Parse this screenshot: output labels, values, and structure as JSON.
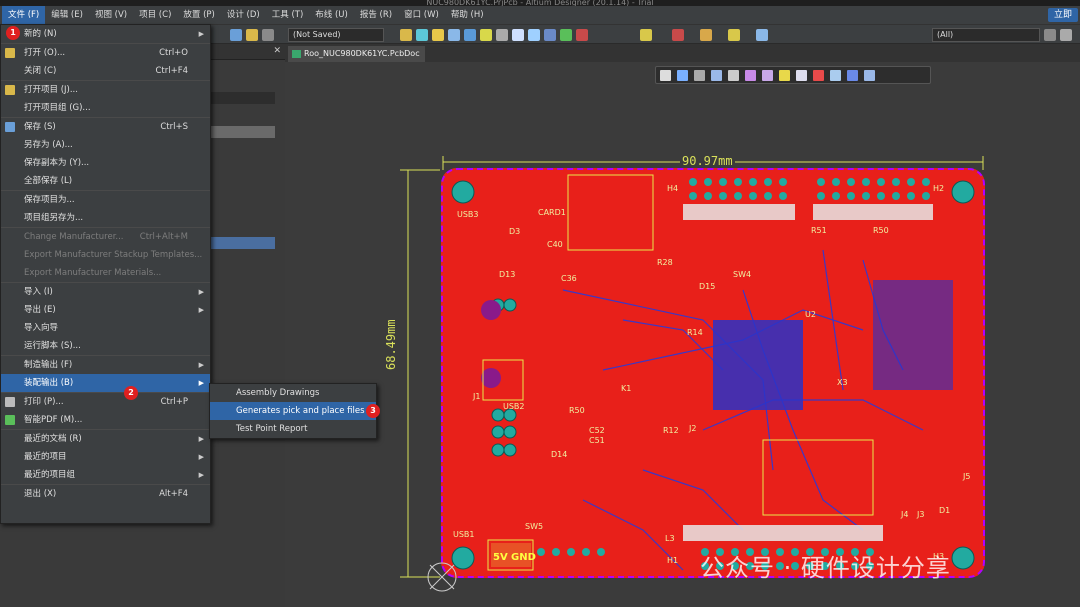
{
  "window": {
    "title": "NUC980DK61YC.PrjPcb - Altium Designer (20.1.14) - Trial"
  },
  "menubar": {
    "items": [
      "文件 (F)",
      "编辑 (E)",
      "视图 (V)",
      "项目 (C)",
      "放置 (P)",
      "设计 (D)",
      "工具 (T)",
      "布线 (U)",
      "报告 (R)",
      "窗口 (W)",
      "帮助 (H)"
    ],
    "right_button": "立即"
  },
  "toolbar": {
    "status": "(Not Saved)",
    "filter": "(All)"
  },
  "doc_tab": {
    "label": "Roo_NUC980DK61YC.PcbDoc"
  },
  "file_menu": {
    "items": [
      {
        "label": "新的 (N)"
      },
      {
        "label": "打开 (O)...",
        "shortcut": "Ctrl+O"
      },
      {
        "label": "关闭 (C)",
        "shortcut": "Ctrl+F4"
      },
      {
        "label": "打开项目 (J)..."
      },
      {
        "label": "打开项目组 (G)..."
      },
      {
        "label": "保存 (S)",
        "shortcut": "Ctrl+S"
      },
      {
        "label": "另存为 (A)..."
      },
      {
        "label": "保存副本为 (Y)..."
      },
      {
        "label": "全部保存 (L)"
      },
      {
        "label": "保存项目为..."
      },
      {
        "label": "项目组另存为..."
      },
      {
        "label": "Change Manufacturer...",
        "shortcut": "Ctrl+Alt+M"
      },
      {
        "label": "Export Manufacturer Stackup Templates..."
      },
      {
        "label": "Export Manufacturer Materials..."
      },
      {
        "label": "导入 (I)"
      },
      {
        "label": "导出 (E)"
      },
      {
        "label": "导入向导"
      },
      {
        "label": "运行脚本 (S)..."
      },
      {
        "label": "制造输出 (F)"
      },
      {
        "label": "装配输出 (B)"
      },
      {
        "label": "打印 (P)...",
        "shortcut": "Ctrl+P"
      },
      {
        "label": "智能PDF (M)..."
      },
      {
        "label": "最近的文档 (R)"
      },
      {
        "label": "最近的项目"
      },
      {
        "label": "最近的项目组"
      },
      {
        "label": "退出 (X)",
        "shortcut": "Alt+F4"
      }
    ]
  },
  "assembly_submenu": {
    "items": [
      "Assembly Drawings",
      "Generates pick and place files",
      "Test Point Report"
    ]
  },
  "badges": [
    "1",
    "2",
    "3"
  ],
  "pcb": {
    "dim_width": "90.97mm",
    "dim_height": "68.49mm",
    "labels": [
      "USB3",
      "CARD1",
      "H4",
      "H2",
      "D3",
      "D13",
      "C40",
      "C36",
      "J1",
      "USB2",
      "R50",
      "K1",
      "C52",
      "C51",
      "D14",
      "SW5",
      "USB1",
      "5V",
      "GND",
      "H1",
      "L3",
      "R12",
      "J2",
      "U2",
      "X3",
      "H3",
      "J5",
      "D1",
      "J4",
      "J3",
      "R51",
      "R50",
      "SW4",
      "D15",
      "R28",
      "R14"
    ]
  },
  "watermark": "公众号 · 硬件设计分享",
  "colors": {
    "menu_highlight": "#2f65a6",
    "board": "#e8201a",
    "badge": "#e02020"
  }
}
